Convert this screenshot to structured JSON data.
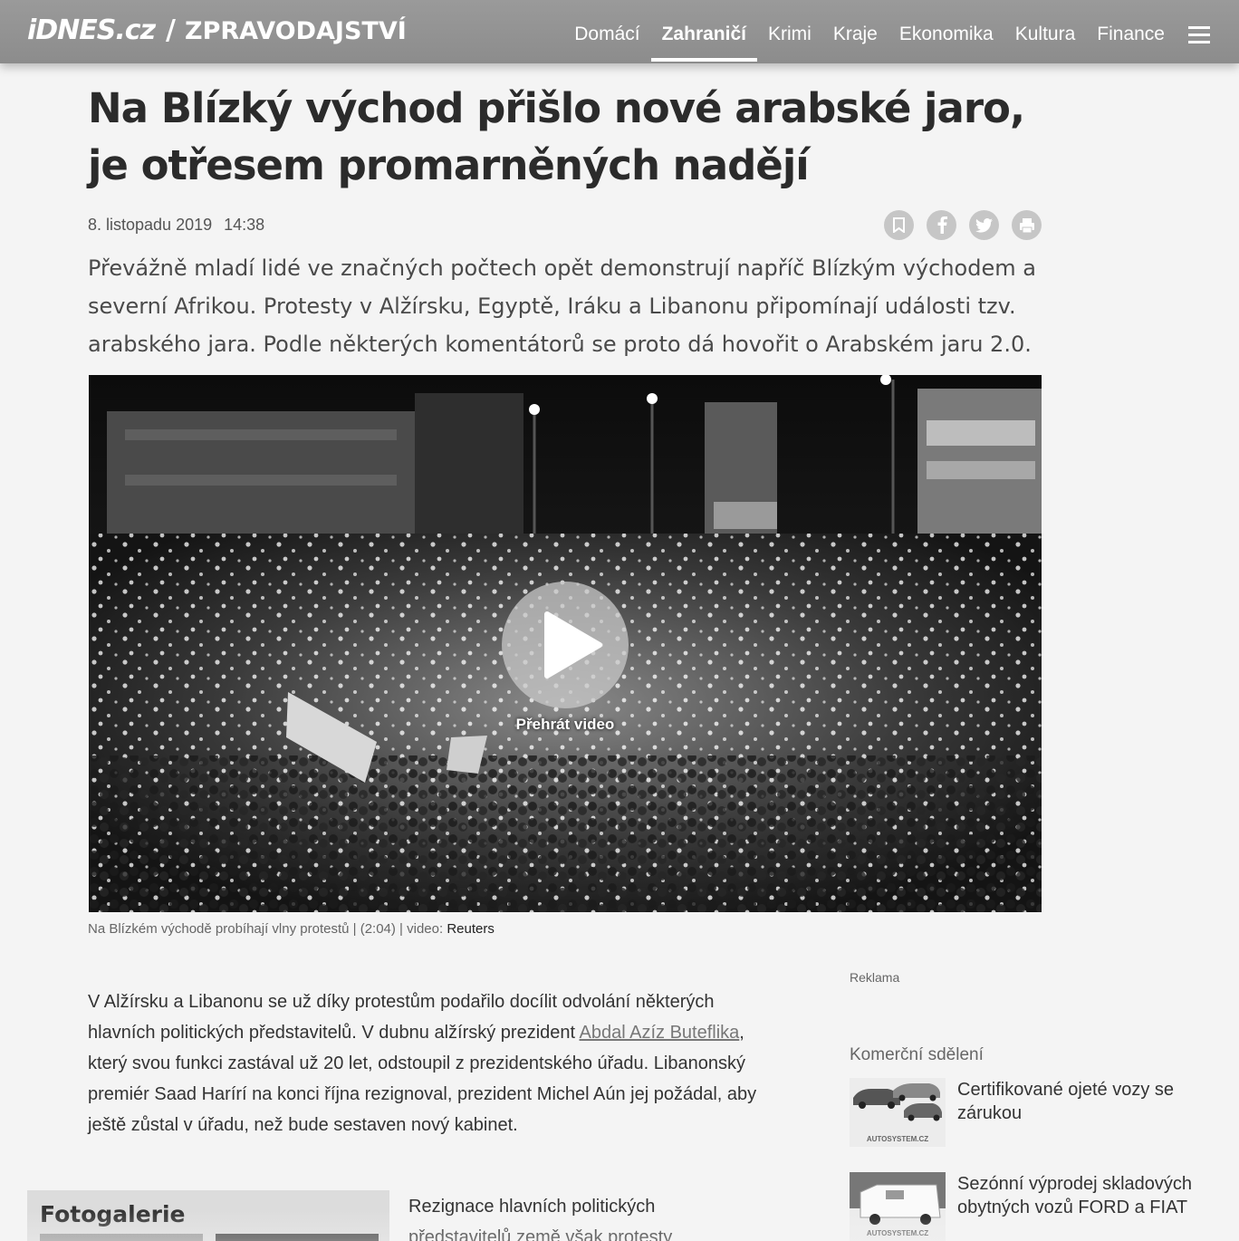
{
  "header": {
    "brand": "iDNES.cz",
    "separator": "/",
    "section": "ZPRAVODAJSTVÍ",
    "nav": [
      {
        "label": "Domácí",
        "active": false
      },
      {
        "label": "Zahraničí",
        "active": true
      },
      {
        "label": "Krimi",
        "active": false
      },
      {
        "label": "Kraje",
        "active": false
      },
      {
        "label": "Ekonomika",
        "active": false
      },
      {
        "label": "Kultura",
        "active": false
      },
      {
        "label": "Finance",
        "active": false
      }
    ],
    "menu_icon": "hamburger-icon"
  },
  "article": {
    "title": "Na Blízký východ přišlo nové arabské jaro, je otřesem promarněných nadějí",
    "date": "8. listopadu 2019",
    "time": "14:38",
    "share_icons": [
      "bookmark-icon",
      "facebook-icon",
      "twitter-icon",
      "print-icon"
    ],
    "perex": "Převážně mladí lidé ve značných počtech opět demonstrují napříč Blízkým východem a severní Afrikou. Protesty v Alžírsku, Egyptě, Iráku a Libanonu připomínají události tzv. arabského jara. Podle některých komentátorů se proto dá hovořit o Arabském jaru 2.0.",
    "video": {
      "play_label": "Přehrát video",
      "caption": "Na Blízkém východě probíhají vlny protestů | (2:04) | video: ",
      "source": "Reuters"
    },
    "paragraph1": {
      "before_link": "V Alžírsku a Libanonu se už díky protestům podařilo docílit odvolání některých hlavních politických představitelů. V dubnu alžírský prezident ",
      "link": "Abdal Azíz Buteflika",
      "after_link": ", který svou funkci zastával už 20 let, odstoupil z prezidentského úřadu. Libanonský premiér Saad Harírí na konci října rezignoval, prezident Michel Aún jej požádal, aby ještě zůstal v úřadu, než bude sestaven nový kabinet."
    },
    "paragraph2": "Rezignace hlavních politických představitelů země však protesty"
  },
  "gallery": {
    "title": "Fotogalerie"
  },
  "sidebar": {
    "ad_label": "Reklama",
    "commercial_title": "Komerční sdělení",
    "promos": [
      {
        "text": "Certifikované ojeté vozy se zárukou",
        "thumb_brand": "AUTOSYSTEM.CZ"
      },
      {
        "text": "Sezónní výprodej skladových obytných vozů FORD a FIAT",
        "thumb_brand": "AUTOSYSTEM.CZ"
      }
    ]
  }
}
